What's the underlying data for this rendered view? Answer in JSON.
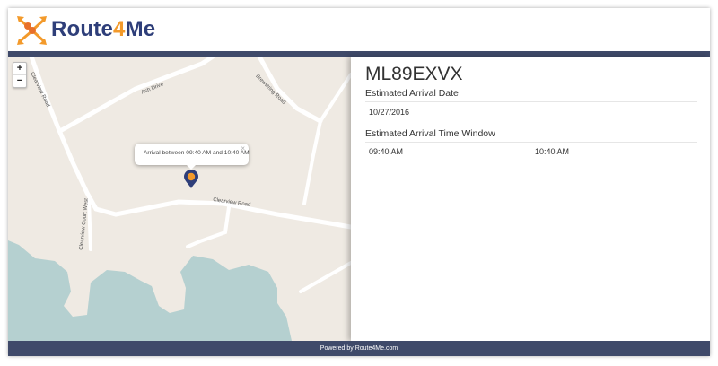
{
  "brand": {
    "name_part1": "Route",
    "name_part2": "4",
    "name_part3": "Me",
    "logo_icon": "route-arrows-icon",
    "colors": {
      "navy": "#2e3e79",
      "orange": "#f39a2b",
      "bar": "#3f4a6a"
    }
  },
  "map": {
    "zoom_in": "+",
    "zoom_out": "−",
    "popup_text": "Arrival between 09:40 AM and 10:40 AM",
    "popup_close": "×",
    "roads": {
      "ash_drive": "Ash Drive",
      "clearview_road_left": "Clearview Road",
      "clearview_road_center": "Clearview Road",
      "brewstring_road": "Brewstring Road",
      "clearview_court_west": "Clearview Court West"
    }
  },
  "details": {
    "vehicle_id": "ML89EXVX",
    "arrival_date_label": "Estimated Arrival Date",
    "arrival_date": "10/27/2016",
    "time_window_label": "Estimated Arrival Time Window",
    "window_start": "09:40 AM",
    "window_end": "10:40 AM"
  },
  "footer": {
    "text": "Powered by Route4Me.com"
  }
}
